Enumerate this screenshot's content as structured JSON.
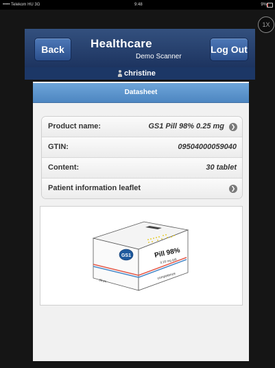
{
  "status_bar": {
    "carrier": "••••• Telekom HU  3G",
    "time": "9:48",
    "battery": "9%"
  },
  "zoom": {
    "label": "1X"
  },
  "header": {
    "back_label": "Back",
    "title": "Healthcare",
    "subtitle": "Demo Scanner",
    "logout_label": "Log Out"
  },
  "user": {
    "name": "christine",
    "icon": "user-icon"
  },
  "datasheet": {
    "title": "Datasheet",
    "rows": [
      {
        "label": "Product name:",
        "value": "GS1 Pill 98% 0.25 mg",
        "arrow": true
      },
      {
        "label": "GTIN:",
        "value": "09504000059040",
        "arrow": false
      },
      {
        "label": "Content:",
        "value": "30 tablet",
        "arrow": false
      },
      {
        "label": "Patient information leaflet",
        "value": "",
        "arrow": true
      }
    ]
  },
  "product_image": {
    "logo": "GS1",
    "name": "Pill 98%",
    "dosage": "0.25 mg /pill",
    "count": "30 pc",
    "brand": "competence"
  },
  "colors": {
    "header_blue": "#1d3460",
    "button_blue": "#2b4f8c",
    "section_blue": "#5b92cb",
    "panel_bg": "#f1f1f1"
  }
}
